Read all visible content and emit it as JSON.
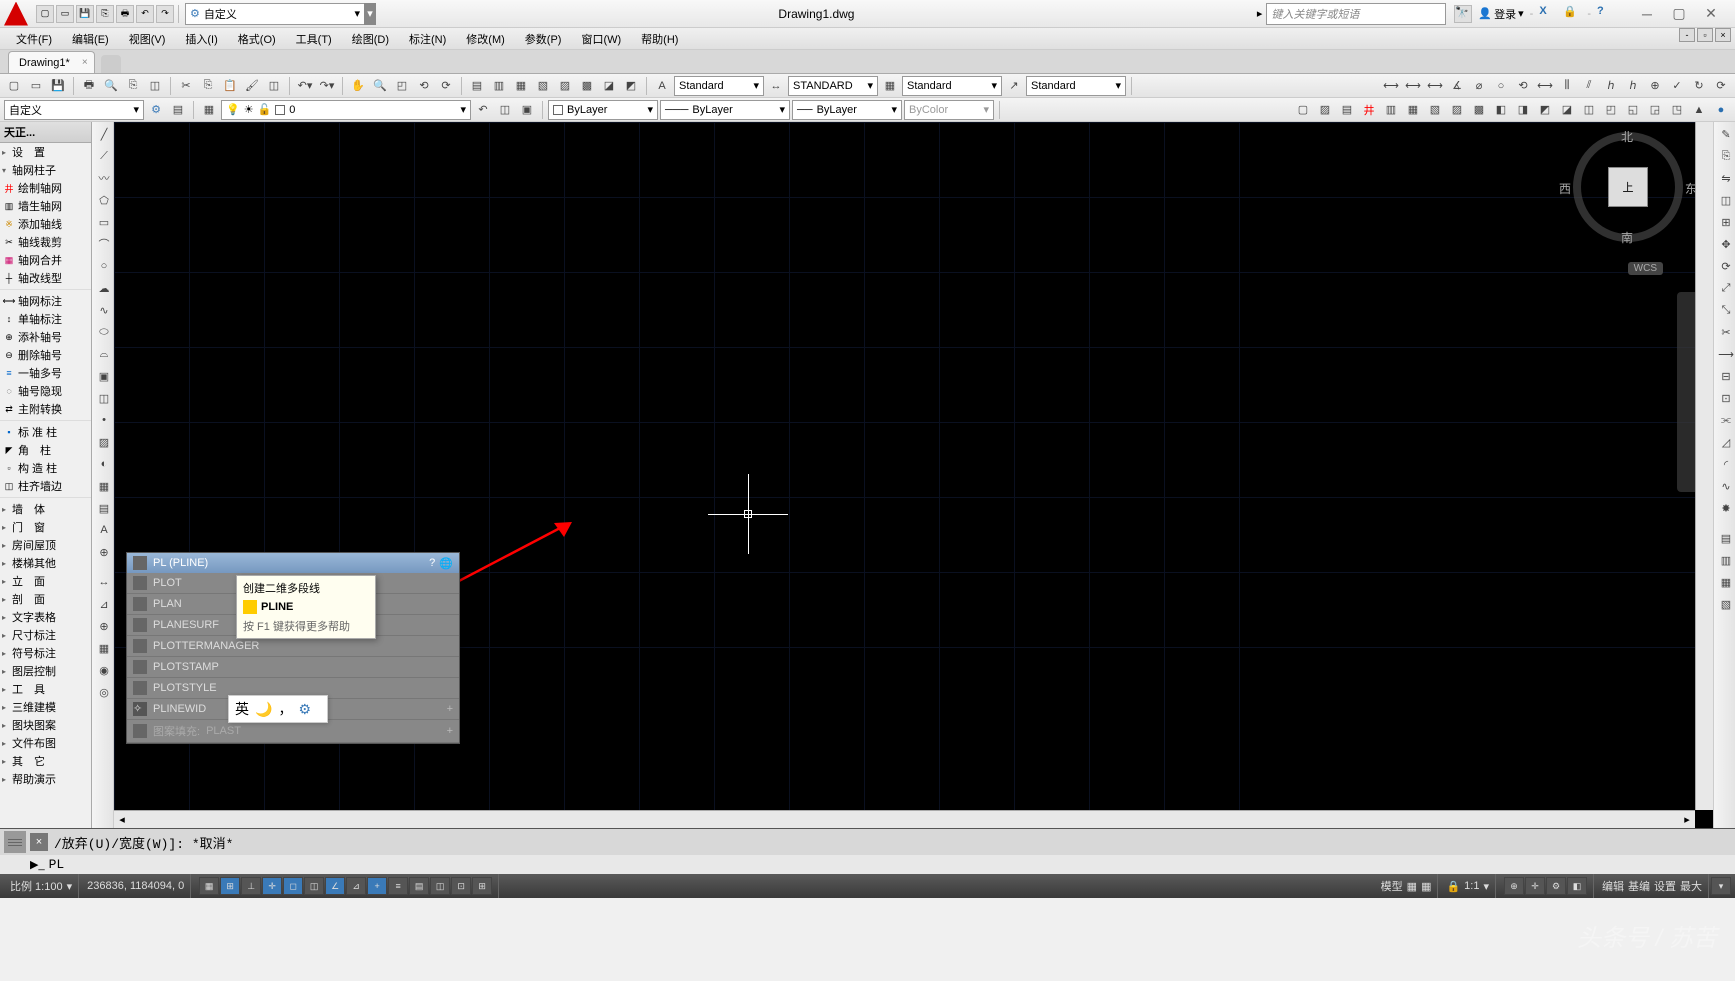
{
  "title": "Drawing1.dwg",
  "search_placeholder": "键入关键字或短语",
  "login_label": "登录",
  "workspace": "自定义",
  "menus": [
    "文件(F)",
    "编辑(E)",
    "视图(V)",
    "插入(I)",
    "格式(O)",
    "工具(T)",
    "绘图(D)",
    "标注(N)",
    "修改(M)",
    "参数(P)",
    "窗口(W)",
    "帮助(H)"
  ],
  "doc_tab": "Drawing1*",
  "styles": {
    "text": "Standard",
    "dim": "STANDARD",
    "table": "Standard",
    "mleader": "Standard"
  },
  "layer_box": "自定义",
  "layer_current": "0",
  "props": {
    "color": "ByLayer",
    "linetype": "ByLayer",
    "lineweight": "ByLayer",
    "plotstyle": "ByColor"
  },
  "left_panel_title": "天正...",
  "tree": {
    "groups": [
      {
        "arrow": "▸",
        "label": "设　置"
      },
      {
        "arrow": "▾",
        "label": "轴网柱子"
      }
    ],
    "axis_items": [
      "绘制轴网",
      "墙生轴网",
      "添加轴线",
      "轴线裁剪",
      "轴网合并",
      "轴改线型"
    ],
    "axis_items2": [
      "轴网标注",
      "单轴标注",
      "添补轴号",
      "删除轴号",
      "一轴多号",
      "轴号隐现",
      "主附转换"
    ],
    "col_items": [
      "标 准 柱",
      "角　柱",
      "构 造 柱",
      "柱齐墙边"
    ],
    "more": [
      "墙　体",
      "门　窗",
      "房间屋顶",
      "楼梯其他",
      "立　面",
      "剖　面",
      "文字表格",
      "尺寸标注",
      "符号标注",
      "图层控制",
      "工　具",
      "三维建模",
      "图块图案",
      "文件布图",
      "其　它",
      "帮助演示"
    ]
  },
  "viewcube": {
    "n": "北",
    "s": "南",
    "e": "东",
    "w": "西",
    "face": "上",
    "wcs": "WCS"
  },
  "autocomplete": {
    "header": "PL (PLINE)",
    "items": [
      "PLOT",
      "PLAN",
      "PLANESURF",
      "PLOTTERMANAGER",
      "PLOTSTAMP",
      "PLOTSTYLE",
      "PLINEWID"
    ],
    "dim_prefix": "图案填充: ",
    "dim_item": "PLAST"
  },
  "tooltip": {
    "line1": "创建二维多段线",
    "cmd": "PLINE",
    "help": "按 F1 键获得更多帮助"
  },
  "ime": "英",
  "cmd_history": "/放弃(U)/宽度(W)]: *取消*",
  "cmd_input": "PL",
  "status": {
    "scale_label": "比例 1:100",
    "coords": "236836, 1184094, 0",
    "model": "模型",
    "anno_scale": "1:1",
    "tabs": [
      "编辑",
      "基编",
      "设置",
      "最大"
    ]
  },
  "watermark": "头条号 / 苏苦"
}
